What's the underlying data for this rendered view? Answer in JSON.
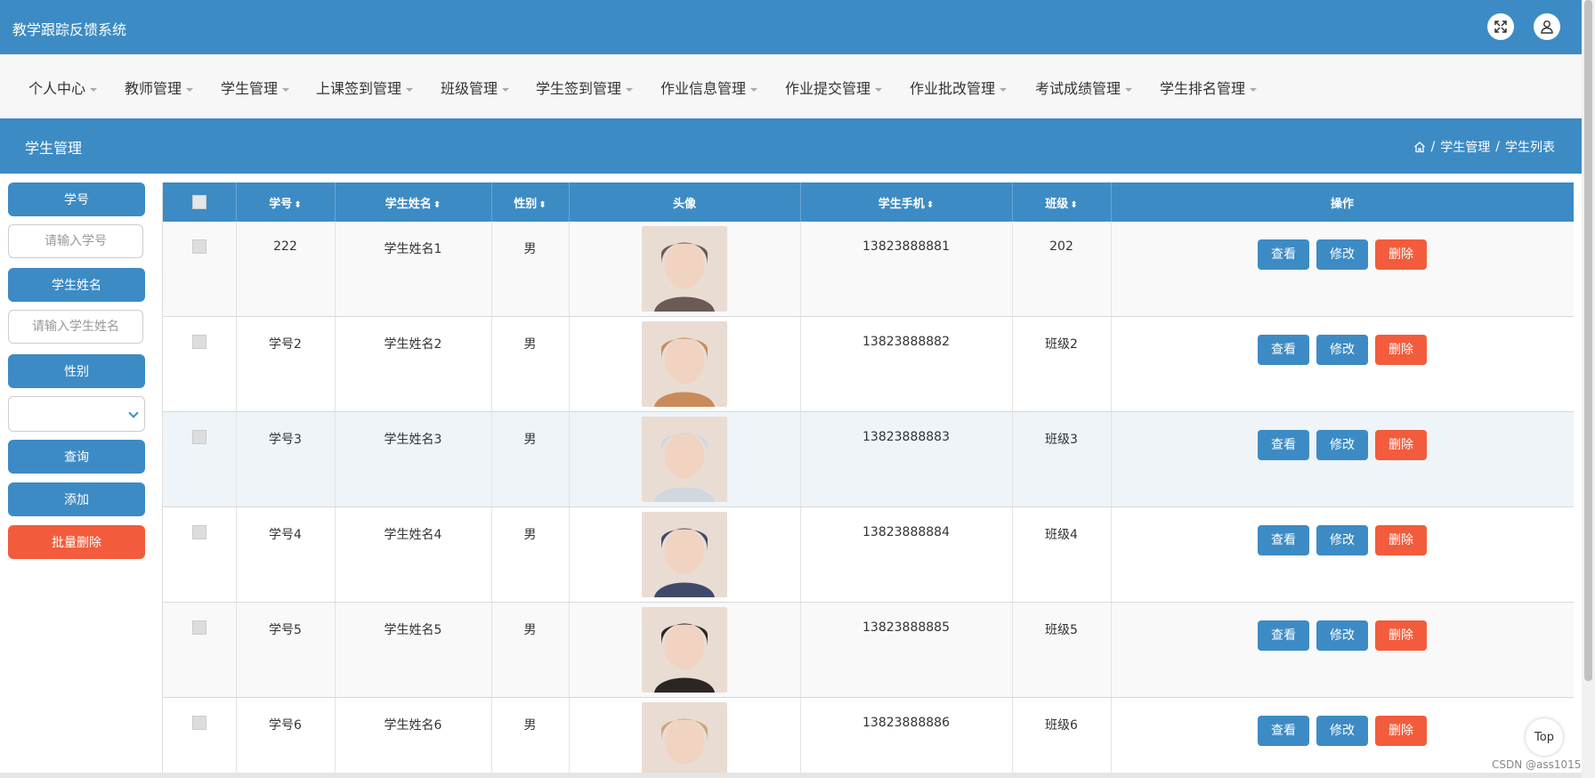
{
  "app": {
    "title": "教学跟踪反馈系统"
  },
  "topbar": {
    "fullscreen_icon": "fullscreen-icon",
    "user_icon": "user-icon"
  },
  "menu": [
    {
      "label": "个人中心"
    },
    {
      "label": "教师管理"
    },
    {
      "label": "学生管理"
    },
    {
      "label": "上课签到管理"
    },
    {
      "label": "班级管理"
    },
    {
      "label": "学生签到管理"
    },
    {
      "label": "作业信息管理"
    },
    {
      "label": "作业提交管理"
    },
    {
      "label": "作业批改管理"
    },
    {
      "label": "考试成绩管理"
    },
    {
      "label": "学生排名管理"
    }
  ],
  "page": {
    "title": "学生管理",
    "breadcrumb": [
      "学生管理",
      "学生列表"
    ]
  },
  "sidebar": {
    "student_no_label": "学号",
    "student_no_placeholder": "请输入学号",
    "student_name_label": "学生姓名",
    "student_name_placeholder": "请输入学生姓名",
    "gender_label": "性别",
    "gender_value": "",
    "query_button": "查询",
    "add_button": "添加",
    "batch_delete_button": "批量删除"
  },
  "table": {
    "columns": [
      "学号",
      "学生姓名",
      "性别",
      "头像",
      "学生手机",
      "班级",
      "操作"
    ],
    "sortable": [
      true,
      true,
      true,
      false,
      true,
      true,
      false
    ],
    "rows": [
      {
        "no": "222",
        "name": "学生姓名1",
        "gender": "男",
        "phone": "13823888881",
        "class": "202",
        "avatar_color": "#6b5a55"
      },
      {
        "no": "学号2",
        "name": "学生姓名2",
        "gender": "男",
        "phone": "13823888882",
        "class": "班级2",
        "avatar_color": "#c98b5a"
      },
      {
        "no": "学号3",
        "name": "学生姓名3",
        "gender": "男",
        "phone": "13823888883",
        "class": "班级3",
        "avatar_color": "#cfd7df"
      },
      {
        "no": "学号4",
        "name": "学生姓名4",
        "gender": "男",
        "phone": "13823888884",
        "class": "班级4",
        "avatar_color": "#3f4a6b"
      },
      {
        "no": "学号5",
        "name": "学生姓名5",
        "gender": "男",
        "phone": "13823888885",
        "class": "班级5",
        "avatar_color": "#2b2624"
      },
      {
        "no": "学号6",
        "name": "学生姓名6",
        "gender": "男",
        "phone": "13823888886",
        "class": "班级6",
        "avatar_color": "#c9a679"
      }
    ],
    "actions": {
      "view": "查看",
      "edit": "修改",
      "delete": "删除"
    }
  },
  "top_button": "Top",
  "watermark": "CSDN @ass1015",
  "colors": {
    "primary": "#3d8bc4",
    "danger": "#f25c3c"
  }
}
